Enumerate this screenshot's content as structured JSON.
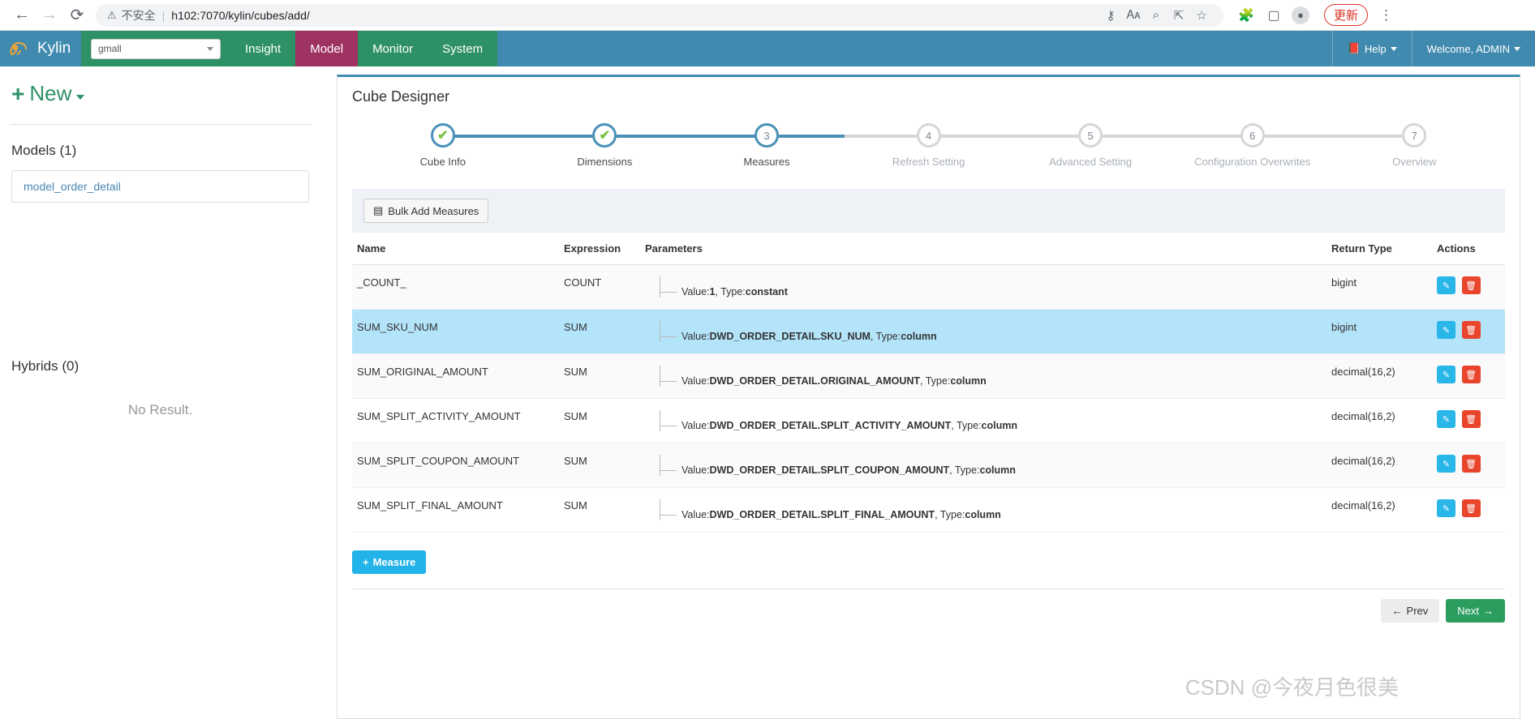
{
  "browser": {
    "back_icon": "arrow-left-icon",
    "forward_icon": "arrow-right-icon",
    "reload_icon": "reload-icon",
    "warning_icon": "warning-triangle-icon",
    "insecure_label": "不安全",
    "separator": "|",
    "url": "h102:7070/kylin/cubes/add/",
    "omni_icons": [
      "key-icon",
      "translate-icon",
      "zoom-out-icon",
      "share-icon",
      "star-icon"
    ],
    "extension_icon": "puzzle-icon",
    "sidepanel_icon": "side-panel-icon",
    "profile_icon": "profile-avatar-icon",
    "update_label": "更新",
    "menu_icon": "kebab-menu-icon"
  },
  "navbar": {
    "brand": "Kylin",
    "project_value": "gmall",
    "items": [
      {
        "label": "Insight",
        "active": false
      },
      {
        "label": "Model",
        "active": true
      },
      {
        "label": "Monitor",
        "active": false
      },
      {
        "label": "System",
        "active": false
      }
    ],
    "help_label": "Help",
    "welcome_label": "Welcome, ADMIN"
  },
  "sidebar": {
    "new_label": "New",
    "models_title": "Models (1)",
    "models": [
      "model_order_detail"
    ],
    "hybrids_title": "Hybrids (0)",
    "hybrids_empty": "No Result."
  },
  "designer": {
    "title": "Cube Designer",
    "steps": [
      {
        "num": "1",
        "label": "Cube Info",
        "state": "done"
      },
      {
        "num": "2",
        "label": "Dimensions",
        "state": "done"
      },
      {
        "num": "3",
        "label": "Measures",
        "state": "current"
      },
      {
        "num": "4",
        "label": "Refresh Setting",
        "state": "pending"
      },
      {
        "num": "5",
        "label": "Advanced Setting",
        "state": "pending"
      },
      {
        "num": "6",
        "label": "Configuration Overwrites",
        "state": "pending"
      },
      {
        "num": "7",
        "label": "Overview",
        "state": "pending"
      }
    ],
    "bulk_add_label": "Bulk Add Measures",
    "bulk_add_icon": "list-icon",
    "table": {
      "headers": [
        "Name",
        "Expression",
        "Parameters",
        "Return Type",
        "Actions"
      ],
      "rows": [
        {
          "name": "_COUNT_",
          "expression": "COUNT",
          "param_prefix": "Value:",
          "param_value": "1",
          "param_type_label": ", Type:",
          "param_type": "constant",
          "return_type": "bigint",
          "selected": false
        },
        {
          "name": "SUM_SKU_NUM",
          "expression": "SUM",
          "param_prefix": "Value:",
          "param_value": "DWD_ORDER_DETAIL.SKU_NUM",
          "param_type_label": ", Type:",
          "param_type": "column",
          "return_type": "bigint",
          "selected": true
        },
        {
          "name": "SUM_ORIGINAL_AMOUNT",
          "expression": "SUM",
          "param_prefix": "Value:",
          "param_value": "DWD_ORDER_DETAIL.ORIGINAL_AMOUNT",
          "param_type_label": ", Type:",
          "param_type": "column",
          "return_type": "decimal(16,2)",
          "selected": false
        },
        {
          "name": "SUM_SPLIT_ACTIVITY_AMOUNT",
          "expression": "SUM",
          "param_prefix": "Value:",
          "param_value": "DWD_ORDER_DETAIL.SPLIT_ACTIVITY_AMOUNT",
          "param_type_label": ", Type:",
          "param_type": "column",
          "return_type": "decimal(16,2)",
          "selected": false
        },
        {
          "name": "SUM_SPLIT_COUPON_AMOUNT",
          "expression": "SUM",
          "param_prefix": "Value:",
          "param_value": "DWD_ORDER_DETAIL.SPLIT_COUPON_AMOUNT",
          "param_type_label": ", Type:",
          "param_type": "column",
          "return_type": "decimal(16,2)",
          "selected": false
        },
        {
          "name": "SUM_SPLIT_FINAL_AMOUNT",
          "expression": "SUM",
          "param_prefix": "Value:",
          "param_value": "DWD_ORDER_DETAIL.SPLIT_FINAL_AMOUNT",
          "param_type_label": ", Type:",
          "param_type": "column",
          "return_type": "decimal(16,2)",
          "selected": false
        }
      ],
      "edit_icon": "pencil-icon",
      "delete_icon": "trash-icon"
    },
    "add_measure_label": "Measure",
    "prev_label": "Prev",
    "next_label": "Next"
  },
  "watermark": "CSDN @今夜月色很美",
  "colors": {
    "brand_blue": "#3f8aae",
    "nav_green": "#2e9166",
    "nav_active": "#9d3263",
    "accent_cyan": "#22b3e8",
    "danger_red": "#e8452c",
    "row_selected": "#b4e4fa",
    "step_done_check": "#7ac143"
  }
}
